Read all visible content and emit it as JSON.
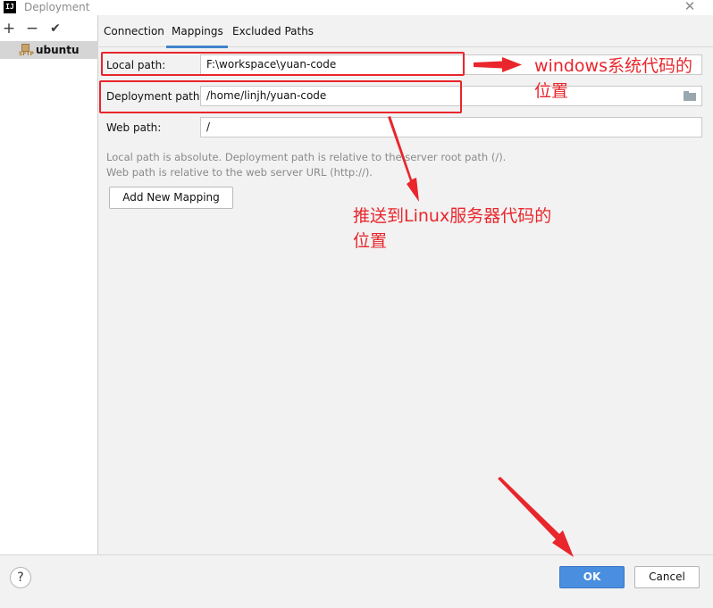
{
  "window": {
    "title": "Deployment",
    "app_icon_text": "IJ",
    "close_glyph": "✕"
  },
  "sidebar": {
    "tool_add": "+",
    "tool_remove": "−",
    "tool_check": "✔",
    "sftp_label": "SFTP",
    "server_name": "ubuntu"
  },
  "tabs": [
    "Connection",
    "Mappings",
    "Excluded Paths"
  ],
  "active_tab": "Mappings",
  "mapping": {
    "local_label": "Local path:",
    "local_value": "F:\\workspace\\yuan-code",
    "deploy_label": "Deployment path:",
    "deploy_value": "/home/linjh/yuan-code",
    "web_label": "Web path:",
    "web_value": "/",
    "help_line1": "Local path is absolute. Deployment path is relative to the server root path (/).",
    "help_line2": "Web path is relative to the web server URL (http://).",
    "add_button": "Add New Mapping"
  },
  "footer": {
    "help_glyph": "?",
    "ok": "OK",
    "cancel": "Cancel"
  },
  "annotations": {
    "note1_line1": "windows系统代码的",
    "note1_line2": "位置",
    "note2_line1": "推送到Linux服务器代码的",
    "note2_line2": "位置",
    "color": "#e8262c"
  },
  "icons": {
    "folder": "folder-icon",
    "help": "question-icon"
  }
}
